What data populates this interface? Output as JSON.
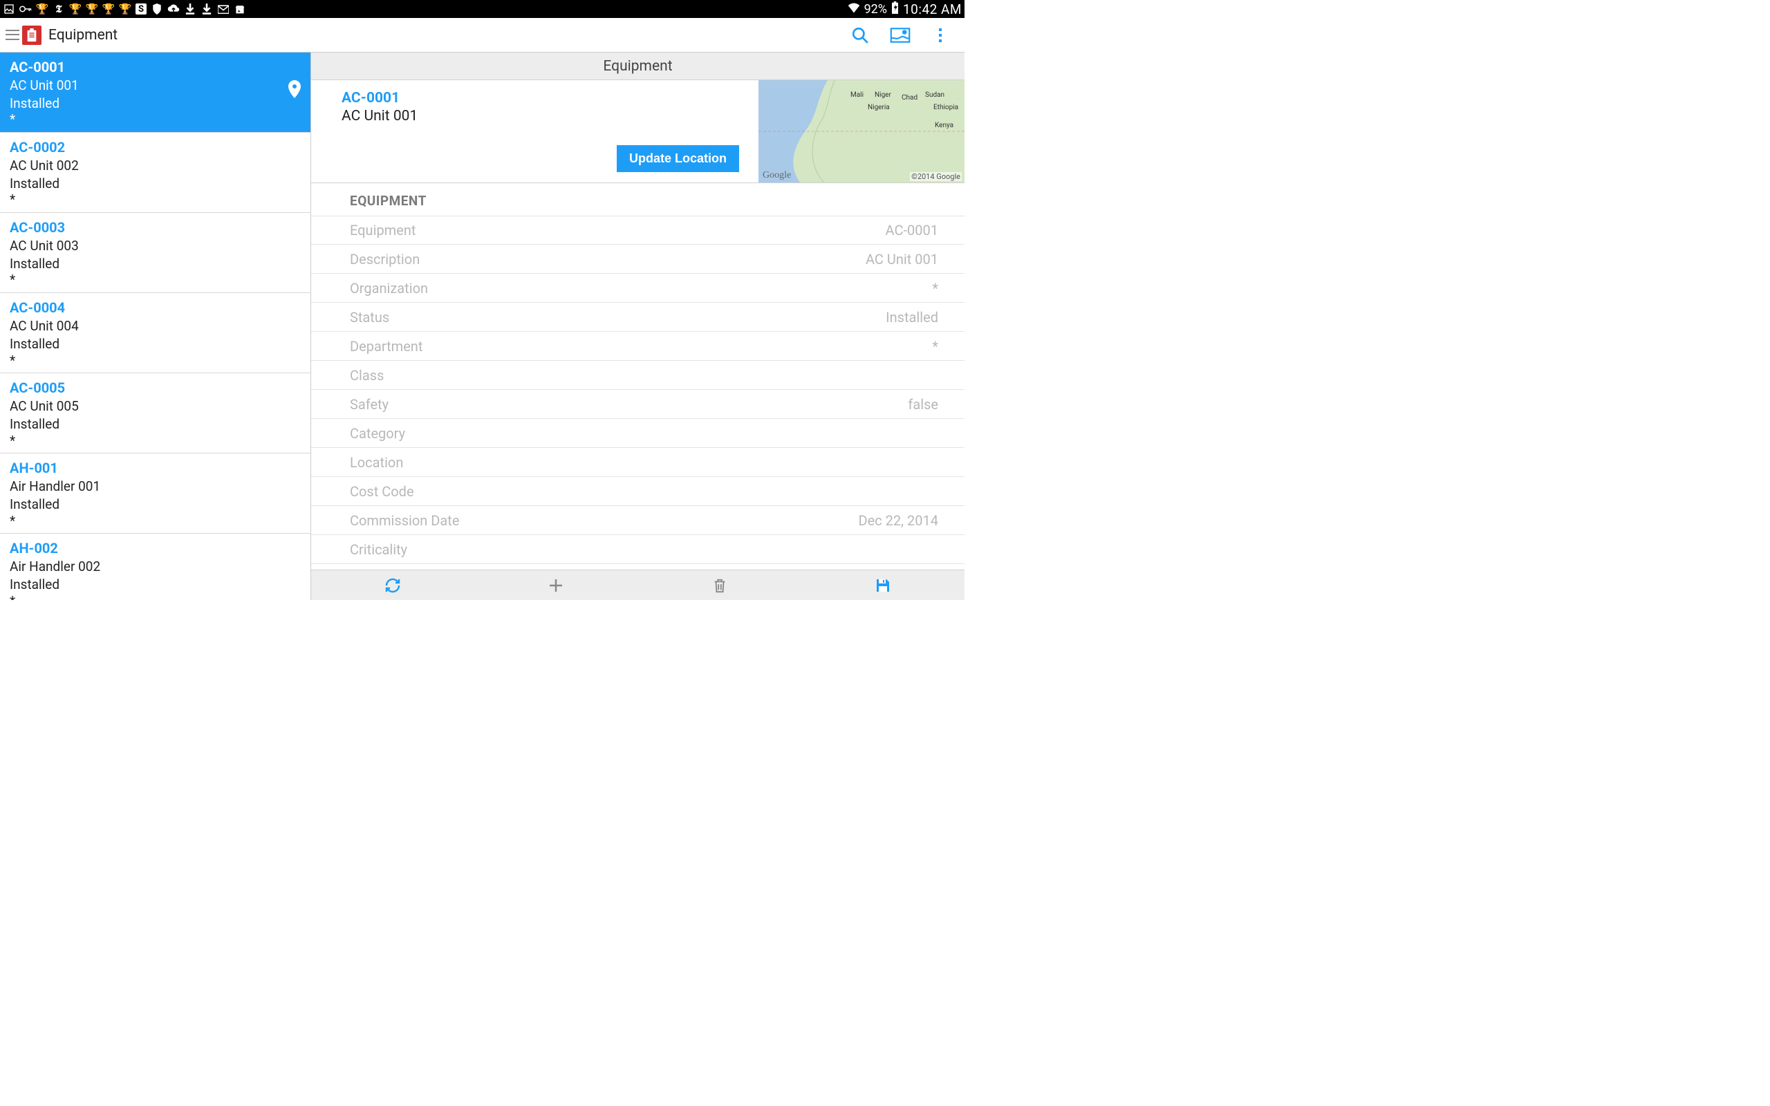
{
  "status_bar": {
    "battery": "92%",
    "time": "10:42 AM",
    "icons": [
      "image-icon",
      "key-icon",
      "trophy-icon",
      "nyt-icon",
      "trophy-icon",
      "trophy-icon",
      "trophy-icon",
      "trophy-icon",
      "skype-icon",
      "shield-icon",
      "cloud-upload-icon",
      "download-icon",
      "download-icon",
      "mail-icon",
      "play-store-icon"
    ]
  },
  "app_bar": {
    "title": "Equipment"
  },
  "equipment_list": [
    {
      "code": "AC-0001",
      "name": "AC Unit 001",
      "status": "Installed",
      "org": "*",
      "selected": true,
      "has_pin": true
    },
    {
      "code": "AC-0002",
      "name": "AC Unit 002",
      "status": "Installed",
      "org": "*",
      "selected": false
    },
    {
      "code": "AC-0003",
      "name": "AC Unit 003",
      "status": "Installed",
      "org": "*",
      "selected": false
    },
    {
      "code": "AC-0004",
      "name": "AC Unit 004",
      "status": "Installed",
      "org": "*",
      "selected": false
    },
    {
      "code": "AC-0005",
      "name": "AC Unit 005",
      "status": "Installed",
      "org": "*",
      "selected": false
    },
    {
      "code": "AH-001",
      "name": "Air Handler 001",
      "status": "Installed",
      "org": "*",
      "selected": false
    },
    {
      "code": "AH-002",
      "name": "Air Handler 002",
      "status": "Installed",
      "org": "*",
      "selected": false
    }
  ],
  "detail": {
    "header": "Equipment",
    "code": "AC-0001",
    "name": "AC Unit 001",
    "update_location_label": "Update Location",
    "section_title": "EQUIPMENT",
    "map": {
      "logo": "Google",
      "attribution": "©2014 Google",
      "labels": [
        "Mali",
        "Niger",
        "Chad",
        "Sudan",
        "Nigeria",
        "Ethiopia",
        "Kenya"
      ]
    },
    "fields": [
      {
        "label": "Equipment",
        "value": "AC-0001"
      },
      {
        "label": "Description",
        "value": "AC Unit 001"
      },
      {
        "label": "Organization",
        "value": "*"
      },
      {
        "label": "Status",
        "value": "Installed"
      },
      {
        "label": "Department",
        "value": "*"
      },
      {
        "label": "Class",
        "value": ""
      },
      {
        "label": "Safety",
        "value": "false"
      },
      {
        "label": "Category",
        "value": ""
      },
      {
        "label": "Location",
        "value": ""
      },
      {
        "label": "Cost Code",
        "value": ""
      },
      {
        "label": "Commission Date",
        "value": "Dec 22, 2014"
      },
      {
        "label": "Criticality",
        "value": ""
      }
    ]
  },
  "bottom_bar": {
    "actions": [
      "refresh",
      "add",
      "delete",
      "save"
    ]
  }
}
